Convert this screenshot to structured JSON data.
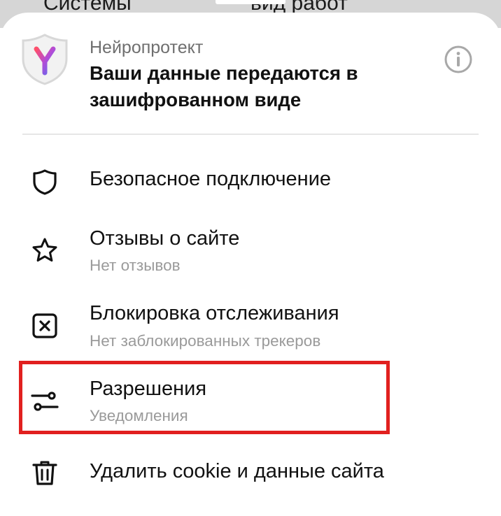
{
  "background": {
    "left_text": "Системы",
    "right_text": "вид работ"
  },
  "header": {
    "subtitle": "Нейропротект",
    "title_line1": "Ваши данные передаются в",
    "title_line2": "зашифрованном виде",
    "logo_icon": "yandex-protect-shield",
    "info_icon": "info-circle"
  },
  "items": [
    {
      "title": "Безопасное подключение",
      "subtitle": "",
      "icon": "shield-outline"
    },
    {
      "title": "Отзывы о сайте",
      "subtitle": "Нет отзывов",
      "icon": "star-outline"
    },
    {
      "title": "Блокировка отслеживания",
      "subtitle": "Нет заблокированных трекеров",
      "icon": "box-x"
    },
    {
      "title": "Разрешения",
      "subtitle": "Уведомления",
      "icon": "sliders",
      "highlighted": true
    },
    {
      "title": "Удалить cookie и данные сайта",
      "subtitle": "",
      "icon": "trash"
    }
  ],
  "colors": {
    "highlight": "#e1201f",
    "text_primary": "#111111",
    "text_secondary": "#9a9a9a"
  }
}
